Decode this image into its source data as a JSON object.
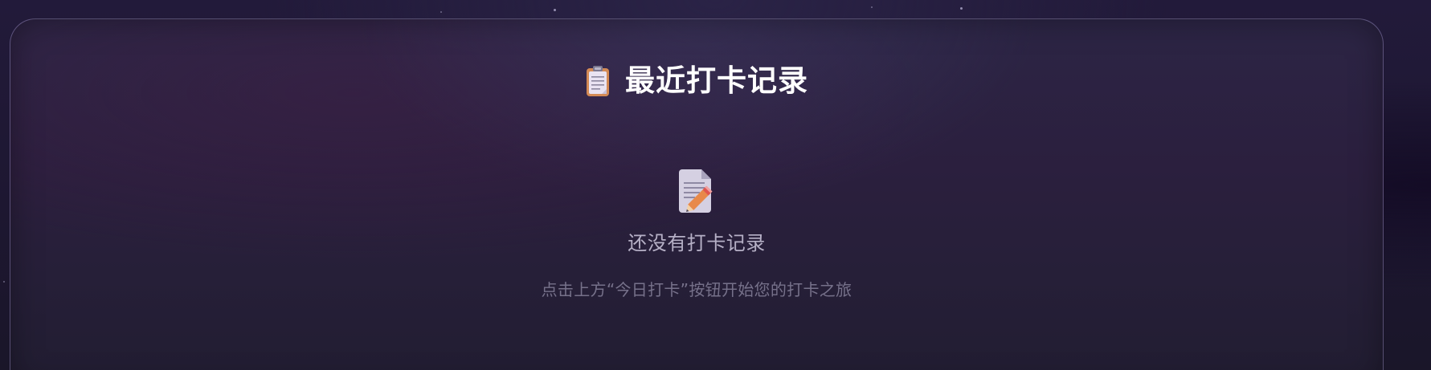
{
  "records_panel": {
    "heading_icon": "clipboard-icon",
    "title": "最近打卡记录",
    "empty_state": {
      "icon": "memo-icon",
      "message": "还没有打卡记录",
      "hint": "点击上方“今日打卡”按钮开始您的打卡之旅"
    }
  },
  "colors": {
    "background": "#1f1933",
    "panel_border": "#8f87b5",
    "title_text": "#ffffff",
    "message_text": "#b6b0c6",
    "hint_text": "#76718a"
  }
}
